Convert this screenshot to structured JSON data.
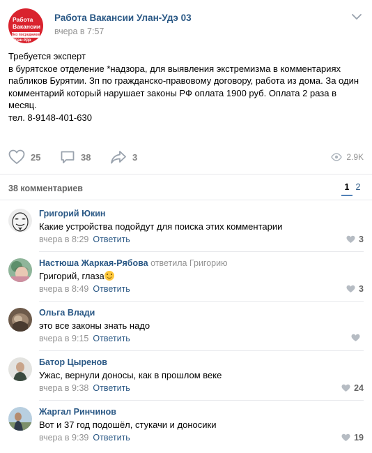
{
  "post": {
    "group_name": "Работа Вакансии Улан-Удэ 03",
    "time": "вчера в 7:57",
    "avatar": {
      "line1": "Работа",
      "line2": "Вакансии",
      "strip": "без посредников",
      "line3": "Улан-Удэ"
    },
    "text": "Требуется эксперт\nв бурятское отделение *надзора, для выявления экстремизма в комментариях пабликов Бурятии. Зп по гражданско-правовому договору, работа из дома. За один комментарий который нарушает законы РФ оплата 1900 руб. Оплата 2 раза в месяц.\nтел. 8-9148-401-630",
    "likes": "25",
    "comments": "38",
    "shares": "3",
    "views": "2.9K"
  },
  "comments_section": {
    "header": "38 комментариев",
    "pages": [
      "1",
      "2"
    ],
    "active_page": "1"
  },
  "comments": [
    {
      "author": "Григорий Юкин",
      "reply_to": "",
      "text": "Какие устройства подойдут для поиска этих комментарии",
      "time": "вчера в 8:29",
      "reply_label": "Ответить",
      "likes": "3"
    },
    {
      "author": "Настюша Жаркая-Рябова",
      "reply_to": "ответила Григорию",
      "text": "Григорий, глаза",
      "time": "вчера в 8:49",
      "reply_label": "Ответить",
      "likes": "3"
    },
    {
      "author": "Ольга Влади",
      "reply_to": "",
      "text": "это все законы знать надо",
      "time": "вчера в 9:15",
      "reply_label": "Ответить",
      "likes": ""
    },
    {
      "author": "Батор Цыренов",
      "reply_to": "",
      "text": "Ужас, вернули доносы, как в прошлом веке",
      "time": "вчера в 9:38",
      "reply_label": "Ответить",
      "likes": "24"
    },
    {
      "author": "Жаргал Ринчинов",
      "reply_to": "",
      "text": "Вот и 37 год подошёл, стукачи и доносики",
      "time": "вчера в 9:39",
      "reply_label": "Ответить",
      "likes": "19"
    }
  ],
  "colors": {
    "link": "#2a5885",
    "muted": "#939393",
    "icon": "#99a2ad",
    "avatar_red": "#d9232e",
    "accent": "#5181b8"
  }
}
